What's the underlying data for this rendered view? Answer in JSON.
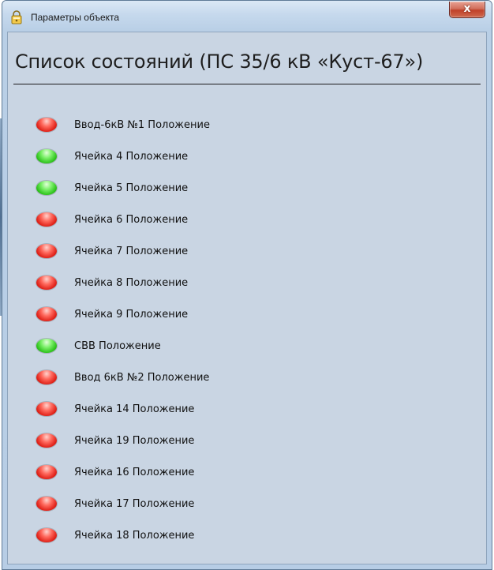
{
  "window": {
    "title": "Параметры объекта",
    "close_label": "x"
  },
  "main": {
    "heading": "Список состояний (ПС 35/6 кВ «Куст-67»)"
  },
  "states": [
    {
      "label": "Ввод-6кВ №1 Положение",
      "status": "red"
    },
    {
      "label": "Ячейка 4 Положение",
      "status": "green"
    },
    {
      "label": "Ячейка 5 Положение",
      "status": "green"
    },
    {
      "label": "Ячейка 6 Положение",
      "status": "red"
    },
    {
      "label": "Ячейка 7 Положение",
      "status": "red"
    },
    {
      "label": "Ячейка 8 Положение",
      "status": "red"
    },
    {
      "label": "Ячейка 9 Положение",
      "status": "red"
    },
    {
      "label": "СВВ Положение",
      "status": "green"
    },
    {
      "label": "Ввод 6кВ №2 Положение",
      "status": "red"
    },
    {
      "label": "Ячейка 14 Положение",
      "status": "red"
    },
    {
      "label": "Ячейка 19 Положение",
      "status": "red"
    },
    {
      "label": "Ячейка 16 Положение",
      "status": "red"
    },
    {
      "label": "Ячейка 17 Положение",
      "status": "red"
    },
    {
      "label": "Ячейка 18 Положение",
      "status": "red"
    }
  ],
  "colors": {
    "status_on": "#2fc31d",
    "status_off": "#e0231a",
    "panel_background": "#c9d5e3"
  },
  "icons": {
    "app": "app-lock-icon",
    "close": "close-icon"
  }
}
